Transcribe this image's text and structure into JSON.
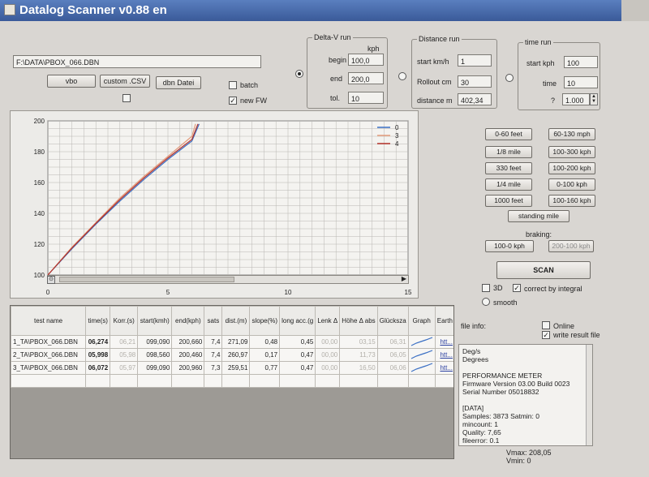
{
  "window": {
    "title": "Datalog Scanner v0.88 en"
  },
  "file": {
    "path": "F:\\DATA\\PBOX_066.DBN",
    "buttons": {
      "vbo": "vbo",
      "csv": "custom .CSV",
      "dbn": "dbn Datei"
    },
    "batch_label": "batch",
    "newfw_label": "new FW",
    "csv_check": false,
    "batch_check": false,
    "newfw_check": true
  },
  "delta_v": {
    "title": "Delta-V run",
    "unit": "kph",
    "begin_label": "begin",
    "begin_value": "100,0",
    "end_label": "end",
    "end_value": "200,0",
    "tol_label": "tol.",
    "tol_value": "10",
    "selected": true
  },
  "distance": {
    "title": "Distance run",
    "start_label": "start km/h",
    "start_value": "1",
    "rollout_label": "Rollout cm",
    "rollout_value": "30",
    "distance_label": "distance m",
    "distance_value": "402,34"
  },
  "time": {
    "title": "time run",
    "start_label": "start kph",
    "start_value": "100",
    "time_label": "time",
    "time_value": "10",
    "q_label": "?",
    "q_value": "1.000"
  },
  "chart_data": {
    "type": "line",
    "xlim": [
      0,
      15
    ],
    "ylim": [
      100,
      200
    ],
    "x_ticks": [
      "0",
      "5",
      "10",
      "15"
    ],
    "y_ticks": [
      "100",
      "120",
      "140",
      "160",
      "180",
      "200"
    ],
    "grid": true,
    "legend_position": "top-right",
    "series": [
      {
        "name": "0",
        "color": "#3a6fc4",
        "x": [
          0,
          1,
          2,
          3,
          4,
          5,
          6,
          6.3
        ],
        "y": [
          100,
          117,
          133,
          148,
          162,
          175,
          187,
          198
        ]
      },
      {
        "name": "3",
        "color": "#e39a7a",
        "x": [
          0,
          1,
          2,
          3,
          4,
          5,
          6,
          6.15
        ],
        "y": [
          100,
          118,
          134,
          150,
          164,
          177,
          190,
          198
        ]
      },
      {
        "name": "4",
        "color": "#b5322a",
        "x": [
          0,
          1,
          2,
          3,
          4,
          5,
          6,
          6.25
        ],
        "y": [
          100,
          117.5,
          133.5,
          149,
          163,
          176,
          188,
          198
        ]
      }
    ]
  },
  "runs": {
    "left": [
      "0-60 feet",
      "1/8 mile",
      "330 feet",
      "1/4 mile",
      "1000 feet"
    ],
    "right": [
      "60-130 mph",
      "100-300 kph",
      "100-200 kph",
      "0-100 kph",
      "100-160 kph"
    ],
    "standing": "standing mile",
    "braking_label": "braking:",
    "braking": [
      "100-0 kph",
      "200-100 kph"
    ]
  },
  "scan": {
    "label": "SCAN",
    "three_d_label": "3D",
    "correct_label": "correct by integral",
    "smooth_label": "smooth"
  },
  "table": {
    "headers": [
      "test name",
      "time(s)",
      "Korr.(s)",
      "start(kmh)",
      "end(kph)",
      "sats",
      "dist.(m)",
      "slope(%)",
      "long acc.(g",
      "Lenk Δ",
      "Höhe Δ abs",
      "Glücksza",
      "Graph",
      "Earth"
    ],
    "rows": [
      [
        "1_TA\\PBOX_066.DBN",
        "06,274",
        "06,21",
        "099,090",
        "200,660",
        "7,4",
        "271,09",
        "0,48",
        "0,45",
        "00,00",
        "03,15",
        "06,31",
        "",
        "htt..."
      ],
      [
        "2_TA\\PBOX_066.DBN",
        "05,998",
        "05,98",
        "098,560",
        "200,460",
        "7,4",
        "260,97",
        "0,17",
        "0,47",
        "00,00",
        "11,73",
        "06,05",
        "",
        "htt..."
      ],
      [
        "3_TA\\PBOX_066.DBN",
        "06,072",
        "05,97",
        "099,090",
        "200,960",
        "7,3",
        "259,51",
        "0,77",
        "0,47",
        "00,00",
        "16,50",
        "06,06",
        "",
        "htt..."
      ]
    ]
  },
  "info": {
    "label": "file info:",
    "online_label": "Online",
    "write_label": "write result file",
    "lines": [
      "Deg/s",
      "Degrees",
      "",
      "PERFORMANCE METER",
      "Firmware Version 03.00 Build 0023",
      "Serial Number 05018832",
      "",
      "[DATA]",
      "Samples: 3873   Satmin: 0",
      "mincount: 1",
      "Quality: 7,65",
      "fileerror: 0.1"
    ],
    "vmax": "Vmax: 208,05",
    "vmin": "Vmin: 0"
  }
}
